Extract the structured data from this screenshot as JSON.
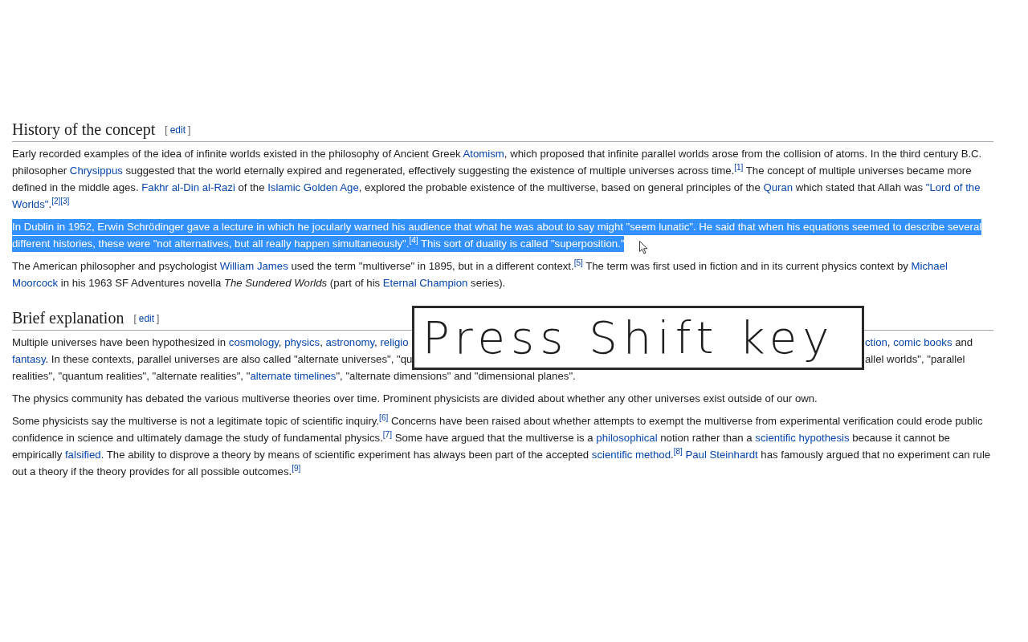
{
  "sections": [
    {
      "heading": "History of the concept",
      "edit": {
        "open": "[",
        "label": "edit",
        "close": "]"
      },
      "paragraphs": [
        {
          "kind": "normal",
          "selected": false,
          "runs": [
            {
              "kind": "text",
              "text": "Early recorded examples of the idea of infinite worlds existed in the philosophy of Ancient Greek "
            },
            {
              "kind": "link",
              "text": "Atomism"
            },
            {
              "kind": "text",
              "text": ", which proposed that infinite parallel worlds arose from the collision of atoms. In the third century B.C. philosopher "
            },
            {
              "kind": "link",
              "text": "Chrysippus"
            },
            {
              "kind": "text",
              "text": " suggested that the world eternally expired and regenerated, effectively suggesting the existence of multiple universes across time."
            },
            {
              "kind": "ref",
              "text": "[1]"
            },
            {
              "kind": "text",
              "text": " The concept of multiple universes became more defined in the middle ages. "
            },
            {
              "kind": "link",
              "text": "Fakhr al-Din al-Razi"
            },
            {
              "kind": "text",
              "text": " of the "
            },
            {
              "kind": "link",
              "text": "Islamic Golden Age"
            },
            {
              "kind": "text",
              "text": ", explored the probable existence of the multiverse, based on general principles of the "
            },
            {
              "kind": "link",
              "text": "Quran"
            },
            {
              "kind": "text",
              "text": " which stated that Allah was "
            },
            {
              "kind": "link",
              "text": "\"Lord of the "
            },
            {
              "kind": "link",
              "text": "Worlds\""
            },
            {
              "kind": "text",
              "text": "."
            },
            {
              "kind": "ref",
              "text": "[2]"
            },
            {
              "kind": "ref",
              "text": "[3]"
            }
          ]
        },
        {
          "kind": "normal",
          "selected": true,
          "runs": [
            {
              "kind": "text",
              "text": "In Dublin in 1952, Erwin Schrödinger gave a lecture in which he jocularly warned his audience that what he was about to say might \"seem lunatic\". He said that when his equations seemed to describe several different histories, these were \"not alternatives, but all really happen simultaneously\"."
            },
            {
              "kind": "ref",
              "text": "[4]"
            },
            {
              "kind": "text",
              "text": " This sort of duality is called \"superposition.\""
            }
          ]
        },
        {
          "kind": "normal",
          "selected": false,
          "runs": [
            {
              "kind": "text",
              "text": "The American philosopher and psychologist "
            },
            {
              "kind": "link",
              "text": "William James"
            },
            {
              "kind": "text",
              "text": " used the term \"multiverse\" in 1895, but in a different context."
            },
            {
              "kind": "ref",
              "text": "[5]"
            },
            {
              "kind": "text",
              "text": " The term was first used in fiction and in its current physics context by "
            },
            {
              "kind": "link",
              "text": "Michael "
            },
            {
              "kind": "link",
              "text": "Moorcock"
            },
            {
              "kind": "text",
              "text": " in his 1963 SF Adventures novella "
            },
            {
              "kind": "italic",
              "text": "The Sundered Worlds"
            },
            {
              "kind": "text",
              "text": " (part of his "
            },
            {
              "kind": "link",
              "text": "Eternal Champion"
            },
            {
              "kind": "text",
              "text": " series)."
            }
          ]
        }
      ]
    },
    {
      "heading": "Brief explanation",
      "edit": {
        "open": "[",
        "label": "edit",
        "close": "]"
      },
      "paragraphs": [
        {
          "kind": "occluded",
          "selected": false,
          "lines": [
            {
              "left": [
                {
                  "kind": "text",
                  "text": "Multiple universes have been hypothesized in "
                },
                {
                  "kind": "link",
                  "text": "cosmology"
                },
                {
                  "kind": "text",
                  "text": ", "
                },
                {
                  "kind": "link",
                  "text": "physics"
                },
                {
                  "kind": "text",
                  "text": ", "
                },
                {
                  "kind": "link",
                  "text": "astronomy"
                },
                {
                  "kind": "text",
                  "text": ", "
                },
                {
                  "kind": "link",
                  "text": "religio"
                }
              ],
              "right": [
                {
                  "kind": "link",
                  "text": "ction"
                },
                {
                  "kind": "text",
                  "text": ", "
                },
                {
                  "kind": "link",
                  "text": "comic books"
                },
                {
                  "kind": "text",
                  "text": " and"
                }
              ]
            },
            {
              "left": [
                {
                  "kind": "link",
                  "text": "fantasy"
                },
                {
                  "kind": "text",
                  "text": ". In these contexts, parallel universes are also called \"alternate universes\", \"qu"
                }
              ],
              "right": [
                {
                  "kind": "text",
                  "text": "allel worlds\", \"parallel"
                }
              ]
            },
            {
              "left": [
                {
                  "kind": "text",
                  "text": "realities\", \"quantum realities\", \"alternate realities\", \""
                },
                {
                  "kind": "link",
                  "text": "alternate timelines"
                },
                {
                  "kind": "text",
                  "text": "\", \"alternate dimensions\" and \"dimensional planes\"."
                }
              ]
            }
          ]
        },
        {
          "kind": "normal",
          "selected": false,
          "runs": [
            {
              "kind": "text",
              "text": "The physics community has debated the various multiverse theories over time. Prominent physicists are divided about whether any other universes exist outside of our own."
            }
          ]
        },
        {
          "kind": "normal",
          "selected": false,
          "runs": [
            {
              "kind": "text",
              "text": "Some physicists say the multiverse is not a legitimate topic of scientific inquiry."
            },
            {
              "kind": "ref",
              "text": "[6]"
            },
            {
              "kind": "text",
              "text": " Concerns have been raised about whether attempts to exempt the multiverse from experimental verification could erode public confidence in science and ultimately damage the study of fundamental physics."
            },
            {
              "kind": "ref",
              "text": "[7]"
            },
            {
              "kind": "text",
              "text": " Some have argued that the multiverse is a "
            },
            {
              "kind": "link",
              "text": "philosophical"
            },
            {
              "kind": "text",
              "text": " notion rather than a "
            },
            {
              "kind": "link",
              "text": "scientific hypothesis"
            },
            {
              "kind": "text",
              "text": " because it cannot be empirically "
            },
            {
              "kind": "link",
              "text": "falsified"
            },
            {
              "kind": "text",
              "text": ". The ability to disprove a theory by means of scientific experiment has always been part of the accepted "
            },
            {
              "kind": "link",
              "text": "scientific method"
            },
            {
              "kind": "text",
              "text": "."
            },
            {
              "kind": "ref",
              "text": "[8]"
            },
            {
              "kind": "link",
              "text": " Paul Steinhardt"
            },
            {
              "kind": "text",
              "text": " has famously argued that no experiment can rule out a theory if the theory provides for all possible outcomes."
            },
            {
              "kind": "ref",
              "text": "[9]"
            }
          ]
        }
      ]
    }
  ],
  "overlay": {
    "text": "Press Shift key"
  }
}
